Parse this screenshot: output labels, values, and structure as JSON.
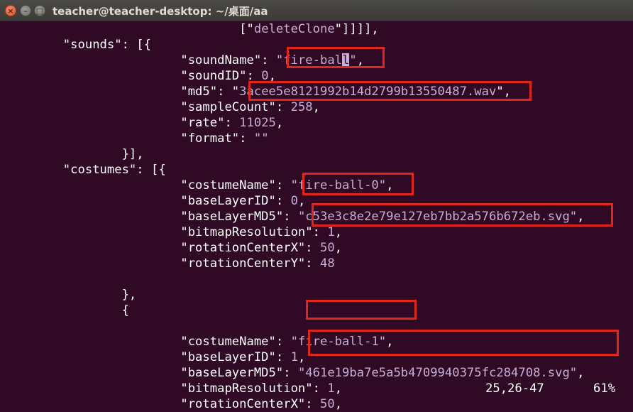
{
  "window": {
    "title": "teacher@teacher-desktop: ~/桌面/aa",
    "close_glyph": "×",
    "minimize_glyph": "–",
    "maximize_glyph": "□"
  },
  "lines": [
    {
      "indent": "                                ",
      "parts": [
        [
          "p",
          "[\""
        ],
        [
          "s",
          "deleteClone"
        ],
        [
          "p",
          "\"]]]],"
        ]
      ]
    },
    {
      "indent": "        ",
      "parts": [
        [
          "k",
          "\"sounds\""
        ],
        [
          "p",
          ": [{"
        ]
      ]
    },
    {
      "indent": "                        ",
      "parts": [
        [
          "k",
          "\"soundName\""
        ],
        [
          "p",
          ": "
        ],
        [
          "s",
          "\"fire-bal"
        ],
        [
          "cursor",
          "l"
        ],
        [
          "s",
          "\""
        ],
        [
          "p",
          ","
        ]
      ]
    },
    {
      "indent": "                        ",
      "parts": [
        [
          "k",
          "\"soundID\""
        ],
        [
          "p",
          ": "
        ],
        [
          "n",
          "0"
        ],
        [
          "p",
          ","
        ]
      ]
    },
    {
      "indent": "                        ",
      "parts": [
        [
          "k",
          "\"md5\""
        ],
        [
          "p",
          ": \""
        ],
        [
          "s",
          "3acee5e8121992b14d2799b13550487.wav"
        ],
        [
          "p",
          "\","
        ]
      ]
    },
    {
      "indent": "                        ",
      "parts": [
        [
          "k",
          "\"sampleCount\""
        ],
        [
          "p",
          ": "
        ],
        [
          "n",
          "258"
        ],
        [
          "p",
          ","
        ]
      ]
    },
    {
      "indent": "                        ",
      "parts": [
        [
          "k",
          "\"rate\""
        ],
        [
          "p",
          ": "
        ],
        [
          "n",
          "11025"
        ],
        [
          "p",
          ","
        ]
      ]
    },
    {
      "indent": "                        ",
      "parts": [
        [
          "k",
          "\"format\""
        ],
        [
          "p",
          ": "
        ],
        [
          "s",
          "\"\""
        ]
      ]
    },
    {
      "indent": "                ",
      "parts": [
        [
          "p",
          "}],"
        ]
      ]
    },
    {
      "indent": "        ",
      "parts": [
        [
          "k",
          "\"costumes\""
        ],
        [
          "p",
          ": [{"
        ]
      ]
    },
    {
      "indent": "                        ",
      "parts": [
        [
          "k",
          "\"costumeName\""
        ],
        [
          "p",
          ": "
        ],
        [
          "s",
          "\"fire-ball-0\""
        ],
        [
          "p",
          ","
        ]
      ]
    },
    {
      "indent": "                        ",
      "parts": [
        [
          "k",
          "\"baseLayerID\""
        ],
        [
          "p",
          ": "
        ],
        [
          "n",
          "0"
        ],
        [
          "p",
          ","
        ]
      ]
    },
    {
      "indent": "                        ",
      "parts": [
        [
          "k",
          "\"baseLayerMD5\""
        ],
        [
          "p",
          ": "
        ],
        [
          "s",
          "\"c53e3c8e2e79e127eb7bb2a576b672eb.svg\""
        ],
        [
          "p",
          ","
        ]
      ]
    },
    {
      "indent": "                        ",
      "parts": [
        [
          "k",
          "\"bitmapResolution\""
        ],
        [
          "p",
          ": "
        ],
        [
          "n",
          "1"
        ],
        [
          "p",
          ","
        ]
      ]
    },
    {
      "indent": "                        ",
      "parts": [
        [
          "k",
          "\"rotationCenterX\""
        ],
        [
          "p",
          ": "
        ],
        [
          "n",
          "50"
        ],
        [
          "p",
          ","
        ]
      ]
    },
    {
      "indent": "                        ",
      "parts": [
        [
          "k",
          "\"rotationCenterY\""
        ],
        [
          "p",
          ": "
        ],
        [
          "n",
          "48"
        ]
      ]
    },
    {
      "indent": "",
      "parts": []
    },
    {
      "indent": "                ",
      "parts": [
        [
          "p",
          "},"
        ]
      ]
    },
    {
      "indent": "                ",
      "parts": [
        [
          "p",
          "{"
        ]
      ]
    },
    {
      "indent": "",
      "parts": []
    },
    {
      "indent": "                        ",
      "parts": [
        [
          "k",
          "\"costumeName\""
        ],
        [
          "p",
          ": "
        ],
        [
          "s",
          "\"fire-ball-1\""
        ],
        [
          "p",
          ","
        ]
      ]
    },
    {
      "indent": "                        ",
      "parts": [
        [
          "k",
          "\"baseLayerID\""
        ],
        [
          "p",
          ": "
        ],
        [
          "n",
          "1"
        ],
        [
          "p",
          ","
        ]
      ]
    },
    {
      "indent": "                        ",
      "parts": [
        [
          "k",
          "\"baseLayerMD5\""
        ],
        [
          "p",
          ": "
        ],
        [
          "s",
          "\"461e19ba7e5a5b4709940375fc284708.svg\""
        ],
        [
          "p",
          ","
        ]
      ]
    },
    {
      "indent": "                        ",
      "parts": [
        [
          "k",
          "\"bitmapResolution\""
        ],
        [
          "p",
          ": "
        ],
        [
          "n",
          "1"
        ],
        [
          "p",
          ","
        ]
      ]
    },
    {
      "indent": "                        ",
      "parts": [
        [
          "k",
          "\"rotationCenterX\""
        ],
        [
          "p",
          ": "
        ],
        [
          "n",
          "50"
        ],
        [
          "p",
          ","
        ]
      ]
    }
  ],
  "status": {
    "position": "25,26-47",
    "percent": "61%"
  },
  "colors": {
    "background": "#300a24",
    "text": "#ffffff",
    "string": "#c6aed6",
    "highlight_box": "#e0261b"
  }
}
